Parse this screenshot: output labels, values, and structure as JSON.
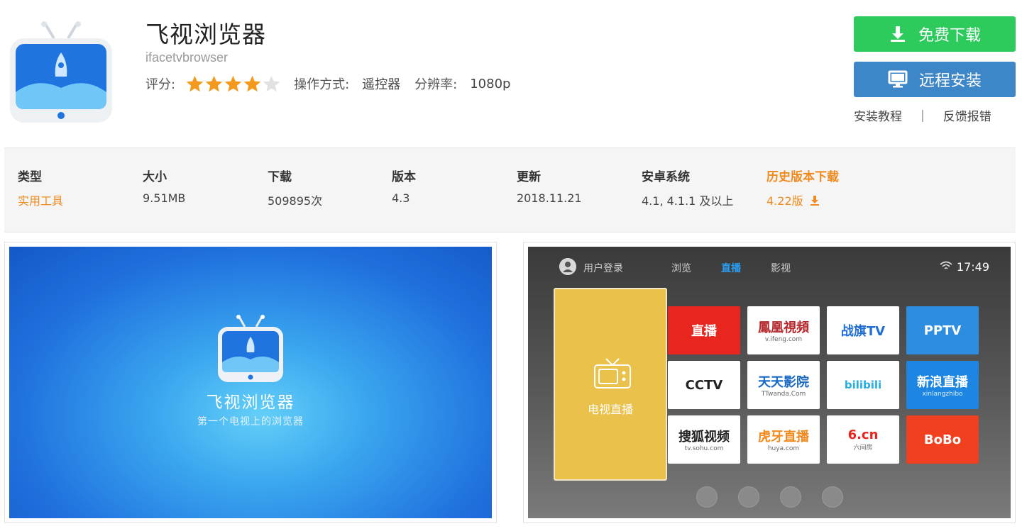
{
  "app": {
    "title": "飞视浏览器",
    "package": "ifacetvbrowser",
    "rating_label": "评分:",
    "rating": 4,
    "rating_max": 5,
    "control_label": "操作方式:",
    "control_value": "遥控器",
    "resolution_label": "分辨率:",
    "resolution_value": "1080p"
  },
  "actions": {
    "download_label": "免费下载",
    "remote_label": "远程安装",
    "tutorial_link": "安装教程",
    "separator": "|",
    "feedback_link": "反馈报错"
  },
  "info": {
    "type_h": "类型",
    "type_v": "实用工具",
    "size_h": "大小",
    "size_v": "9.51MB",
    "dl_h": "下载",
    "dl_v": "509895次",
    "ver_h": "版本",
    "ver_v": "4.3",
    "upd_h": "更新",
    "upd_v": "2018.11.21",
    "os_h": "安卓系统",
    "os_v": "4.1, 4.1.1 及以上",
    "hist_h": "历史版本下载",
    "hist_v": "4.22版"
  },
  "shot1": {
    "title": "飞视浏览器",
    "subtitle": "第一个电视上的浏览器"
  },
  "shot2": {
    "login": "用户登录",
    "tab_browse": "浏览",
    "tab_live": "直播",
    "tab_video": "影视",
    "time": "17:49",
    "big_tile": "电视直播",
    "tiles": [
      "直播",
      "鳳凰視頻",
      "战旗TV",
      "PPTV",
      "CCTV",
      "天天影院",
      "bilibili",
      "新浪直播",
      "搜狐视频",
      "虎牙直播",
      "6.cn",
      "BoBo"
    ],
    "tile_subs": [
      "",
      "v.ifeng.com",
      "",
      "",
      "",
      "TTwanda.Com",
      "",
      "xinlangzhibo",
      "tv.sohu.com",
      "huya.com",
      "六间房",
      ""
    ]
  },
  "colors": {
    "download": "#2ccb5c",
    "remote": "#3d87c9",
    "star": "#f39a1e",
    "accent_orange": "#f08a1e"
  }
}
